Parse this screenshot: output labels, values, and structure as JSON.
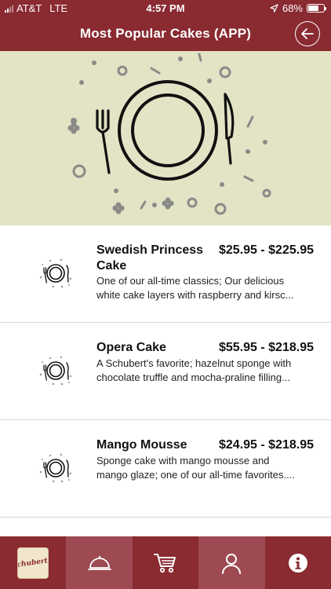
{
  "status_bar": {
    "carrier": "AT&T",
    "network": "LTE",
    "time": "4:57 PM",
    "battery": "68%",
    "battery_level": 0.68
  },
  "header": {
    "title": "Most Popular Cakes (APP)",
    "back_icon": "arrow-left-circle-icon"
  },
  "hero": {
    "icon": "plate-fork-knife-icon"
  },
  "cakes": [
    {
      "name_lines": [
        "Swedish Princess",
        "Cake"
      ],
      "price": "$25.95 - $225.95",
      "desc_lines": [
        "One of our all-time classics; Our delicious",
        "white cake layers with raspberry and kirsc..."
      ]
    },
    {
      "name_lines": [
        "Opera Cake"
      ],
      "price": "$55.95 - $218.95",
      "desc_lines": [
        "A Schubert's favorite; hazelnut sponge with",
        "chocolate truffle and mocha-praline filling..."
      ]
    },
    {
      "name_lines": [
        "Mango Mousse"
      ],
      "price": "$24.95 - $218.95",
      "desc_lines": [
        "Sponge cake with mango mousse and",
        "mango glaze; one of our all-time favorites...."
      ]
    }
  ],
  "tab_bar": {
    "logo_text": "Schubert's",
    "tabs": [
      "home-logo",
      "cloche-icon",
      "cart-icon",
      "user-icon",
      "info-icon"
    ]
  },
  "colors": {
    "brand": "#8a2a31",
    "tab_alt": "#9e4a52",
    "hero_bg": "#e3e3c6"
  }
}
